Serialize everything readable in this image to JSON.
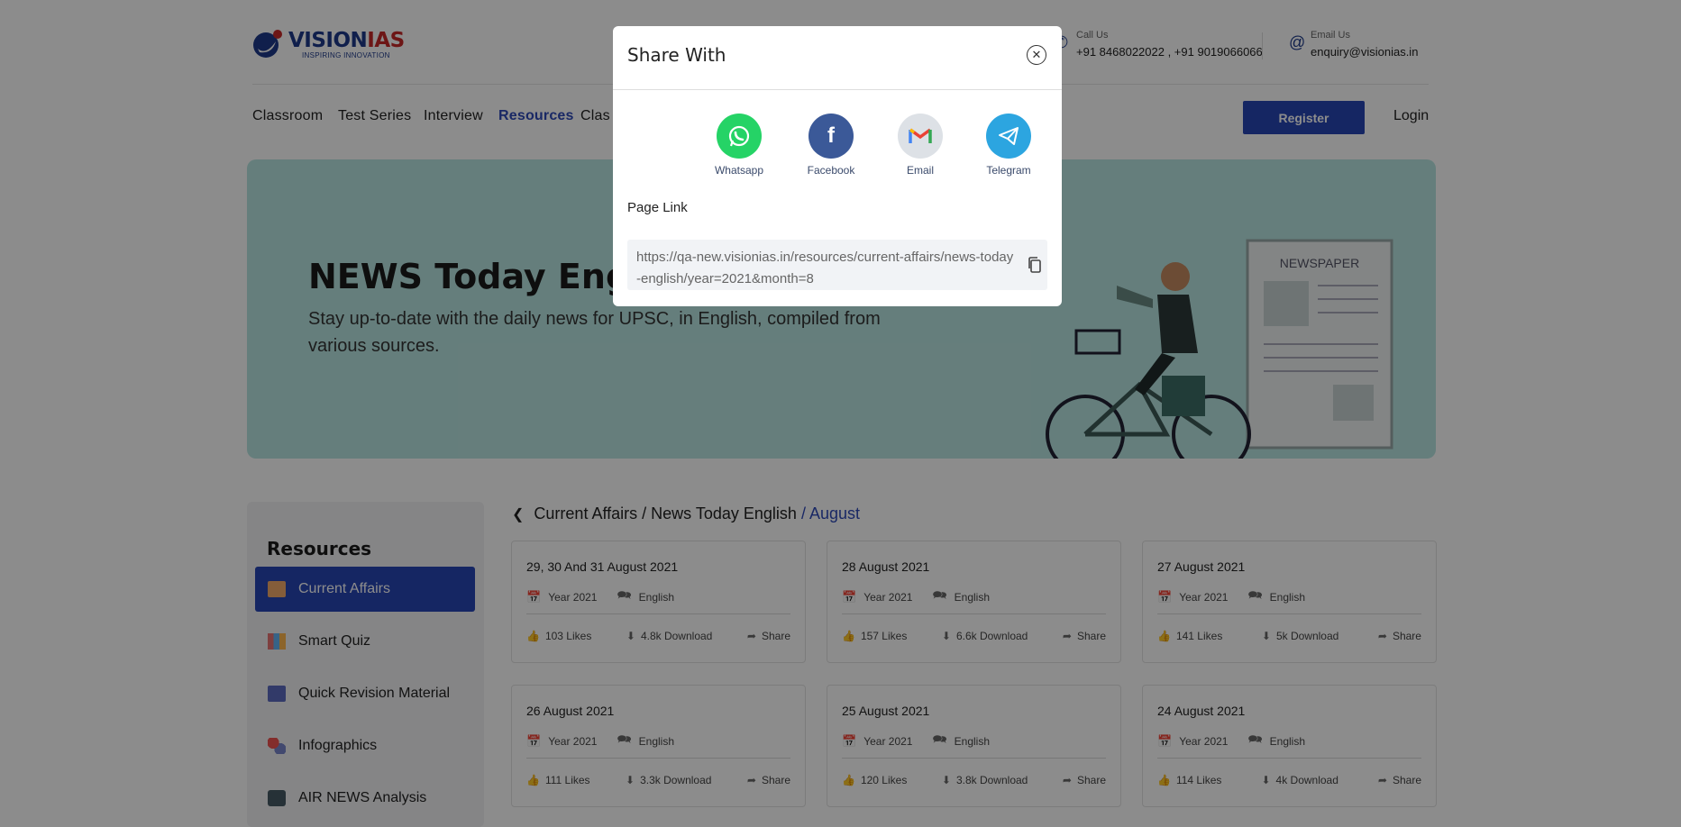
{
  "header": {
    "brand_main": "VISION",
    "brand_accent": "IAS",
    "brand_tagline": "INSPIRING INNOVATION",
    "call_label": "Call Us",
    "call_value": "+91 8468022022 , +91 9019066066",
    "email_label": "Email Us",
    "email_value": "enquiry@visionias.in"
  },
  "nav": {
    "items": [
      "Classroom",
      "Test Series",
      "Interview",
      "Resources",
      "Clas"
    ],
    "active": "Resources",
    "register_label": "Register",
    "login_label": "Login"
  },
  "hero": {
    "title": "NEWS Today Englis",
    "subtitle": "Stay up-to-date with the daily news for UPSC, in English, compiled from various sources.",
    "illustration_text": "NEWSPAPER"
  },
  "sidebar": {
    "title": "Resources",
    "items": [
      {
        "label": "Current Affairs",
        "active": true
      },
      {
        "label": "Smart Quiz"
      },
      {
        "label": "Quick Revision Material"
      },
      {
        "label": "Infographics"
      },
      {
        "label": "AIR NEWS Analysis"
      }
    ]
  },
  "breadcrumb": {
    "items": [
      "Current Affairs",
      "/ News Today English",
      "/ August"
    ]
  },
  "cards": [
    {
      "title": "29, 30 And 31 August 2021",
      "year": "Year 2021",
      "lang": "English",
      "likes": "103 Likes",
      "downloads": "4.8k Download",
      "share": "Share"
    },
    {
      "title": "28 August 2021",
      "year": "Year 2021",
      "lang": "English",
      "likes": "157 Likes",
      "downloads": "6.6k Download",
      "share": "Share"
    },
    {
      "title": "27 August 2021",
      "year": "Year 2021",
      "lang": "English",
      "likes": "141 Likes",
      "downloads": "5k Download",
      "share": "Share"
    },
    {
      "title": "26 August 2021",
      "year": "Year 2021",
      "lang": "English",
      "likes": "111 Likes",
      "downloads": "3.3k Download",
      "share": "Share"
    },
    {
      "title": "25 August 2021",
      "year": "Year 2021",
      "lang": "English",
      "likes": "120 Likes",
      "downloads": "3.8k Download",
      "share": "Share"
    },
    {
      "title": "24 August 2021",
      "year": "Year 2021",
      "lang": "English",
      "likes": "114 Likes",
      "downloads": "4k Download",
      "share": "Share"
    }
  ],
  "modal": {
    "title": "Share With",
    "options": [
      {
        "label": "Whatsapp",
        "icon": "whatsapp-icon",
        "color": "#25d366"
      },
      {
        "label": "Facebook",
        "icon": "facebook-icon",
        "color": "#3b5998"
      },
      {
        "label": "Email",
        "icon": "gmail-icon",
        "color": "#dde1e6"
      },
      {
        "label": "Telegram",
        "icon": "telegram-icon",
        "color": "#2ca5e0"
      }
    ],
    "page_link_label": "Page Link",
    "page_link": "https://qa-new.visionias.in/resources/current-affairs/news-today-english/year=2021&month=8"
  },
  "colors": {
    "primary": "#2745b5",
    "hero_bg": "#b9e6e2",
    "overlay": "rgba(0,0,0,0.45)"
  }
}
